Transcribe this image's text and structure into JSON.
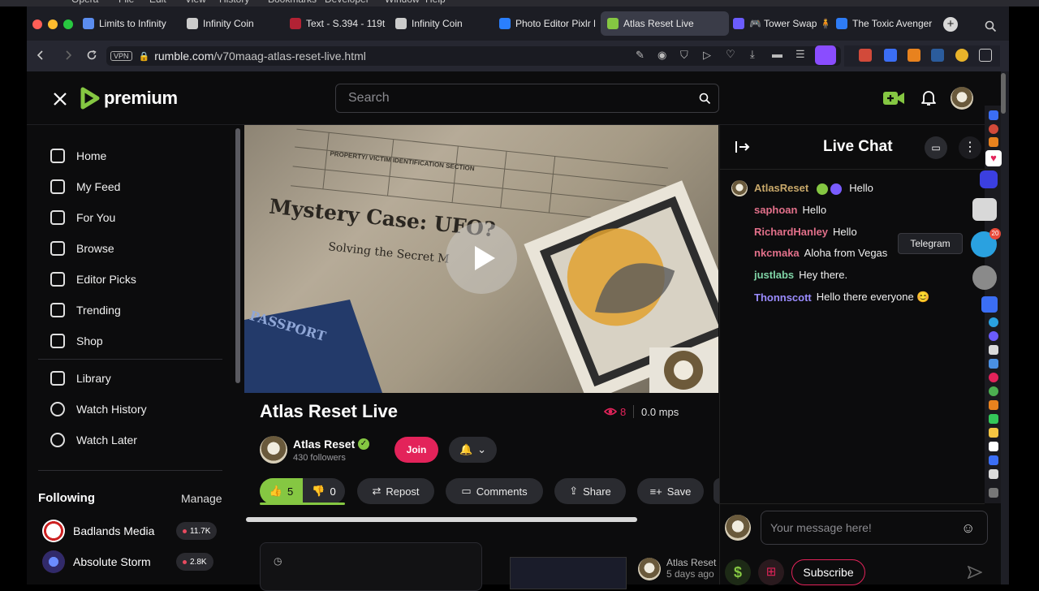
{
  "menubar": {
    "items": [
      "Opera",
      "File",
      "Edit",
      "View",
      "History",
      "Bookmarks",
      "Developer",
      "Window",
      "Help"
    ]
  },
  "tabs": [
    {
      "label": "Limits to Infinity",
      "color": "#5b8def"
    },
    {
      "label": "Infinity Coin",
      "color": "#cccccc"
    },
    {
      "label": "Text - S.394 - 119t",
      "color": "#b22234"
    },
    {
      "label": "Infinity Coin",
      "color": "#cccccc"
    },
    {
      "label": "Photo Editor Pixlr F",
      "color": "#2a7fff"
    },
    {
      "label": "Atlas Reset Live",
      "color": "#85c742"
    },
    {
      "label": "🎮 Tower Swap 🧍",
      "color": "#6b5cff"
    },
    {
      "label": "The Toxic Avenger",
      "color": "#2e7cf6"
    }
  ],
  "address": {
    "vpn": "VPN",
    "host": "rumble.com",
    "path": "/v70maag-atlas-reset-live.html"
  },
  "topbar": {
    "logo": "premium",
    "search_placeholder": "Search"
  },
  "nav": {
    "primary": [
      {
        "label": "Home",
        "icon": "home-icon"
      },
      {
        "label": "My Feed",
        "icon": "feed-icon"
      },
      {
        "label": "For You",
        "icon": "target-icon"
      },
      {
        "label": "Browse",
        "icon": "browse-icon"
      },
      {
        "label": "Editor Picks",
        "icon": "ribbon-icon"
      },
      {
        "label": "Trending",
        "icon": "trending-icon"
      },
      {
        "label": "Shop",
        "icon": "shop-icon"
      }
    ],
    "secondary": [
      {
        "label": "Library",
        "icon": "library-icon"
      },
      {
        "label": "Watch History",
        "icon": "history-icon"
      },
      {
        "label": "Watch Later",
        "icon": "clock-icon"
      }
    ],
    "following_title": "Following",
    "manage": "Manage",
    "following": [
      {
        "name": "Badlands Media",
        "count": "11.7K"
      },
      {
        "name": "Absolute Storm",
        "count": "2.8K"
      }
    ]
  },
  "video": {
    "overlay_title": "Mystery Case: UFO?",
    "overlay_sub": "Solving the Secret M",
    "form_header": "PROPERTY/ VICTIM IDENTIFICATION SECTION",
    "passport": "PASSPORT"
  },
  "info": {
    "title": "Atlas Reset Live",
    "viewers": "8",
    "rate": "0.0 mps",
    "channel": "Atlas Reset",
    "followers": "430 followers",
    "join": "Join",
    "likes": "5",
    "dislikes": "0",
    "repost": "Repost",
    "comments": "Comments",
    "share": "Share",
    "save": "Save"
  },
  "related": {
    "channel": "Atlas Reset",
    "ago": "5 days ago"
  },
  "chat": {
    "title": "Live Chat",
    "messages": [
      {
        "user": "AtlasReset",
        "text": "Hello",
        "color": "#c8a86a"
      },
      {
        "user": "saphoan",
        "text": "Hello",
        "color": "#e2708a"
      },
      {
        "user": "RichardHanley",
        "text": "Hello",
        "color": "#e2708a"
      },
      {
        "user": "nkcmaka",
        "text": "Aloha from Vegas",
        "color": "#e2708a"
      },
      {
        "user": "justlabs",
        "text": "Hey there.",
        "color": "#7fd4a6"
      },
      {
        "user": "Thonnscott",
        "text": "Hello there everyone 😊",
        "color": "#9b8cff"
      }
    ],
    "placeholder": "Your message here!",
    "subscribe": "Subscribe",
    "tooltip": "Telegram",
    "telegram_badge": "20"
  },
  "colors": {
    "accent": "#85c742",
    "join": "#e3235a",
    "like_bg": "#85c742"
  }
}
